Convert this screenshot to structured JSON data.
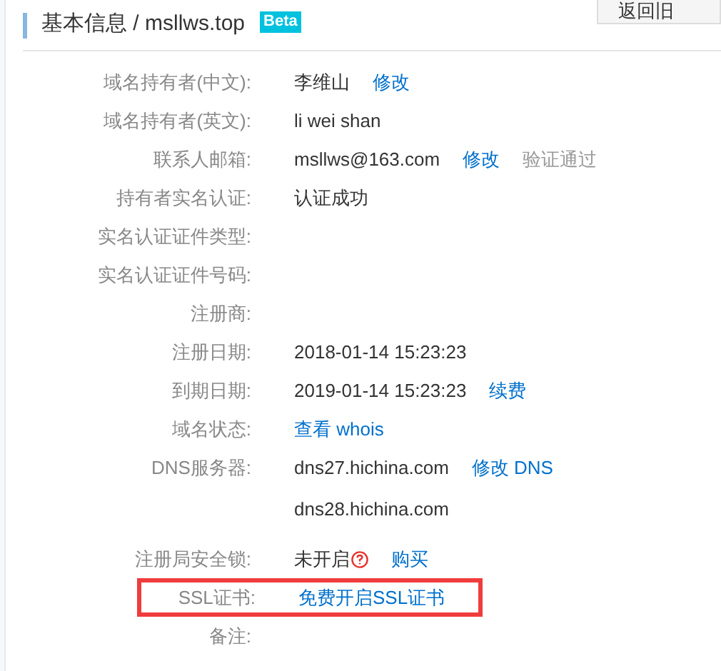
{
  "header": {
    "title": "基本信息 / msllws.top",
    "badge": "Beta",
    "back_button": "返回旧"
  },
  "rows": [
    {
      "label": "域名持有者(中文):",
      "highlighted": false,
      "items": [
        {
          "kind": "text",
          "text": "李维山"
        },
        {
          "kind": "link",
          "text": "修改"
        }
      ]
    },
    {
      "label": "域名持有者(英文):",
      "highlighted": false,
      "items": [
        {
          "kind": "text",
          "text": "li wei shan"
        }
      ]
    },
    {
      "label": "联系人邮箱:",
      "highlighted": false,
      "items": [
        {
          "kind": "text",
          "text": "msllws@163.com"
        },
        {
          "kind": "link",
          "text": "修改"
        },
        {
          "kind": "muted",
          "text": "验证通过"
        }
      ]
    },
    {
      "label": "持有者实名认证:",
      "highlighted": false,
      "items": [
        {
          "kind": "text",
          "text": "认证成功"
        }
      ]
    },
    {
      "label": "实名认证证件类型:",
      "highlighted": false,
      "items": []
    },
    {
      "label": "实名认证证件号码:",
      "highlighted": false,
      "items": []
    },
    {
      "label": "注册商:",
      "highlighted": false,
      "items": []
    },
    {
      "label": "注册日期:",
      "highlighted": false,
      "items": [
        {
          "kind": "text",
          "text": "2018-01-14 15:23:23"
        }
      ]
    },
    {
      "label": "到期日期:",
      "highlighted": false,
      "items": [
        {
          "kind": "text",
          "text": "2019-01-14 15:23:23"
        },
        {
          "kind": "link",
          "text": "续费"
        }
      ]
    },
    {
      "label": "域名状态:",
      "highlighted": false,
      "items": [
        {
          "kind": "link",
          "text": "查看 whois"
        }
      ]
    },
    {
      "label": "DNS服务器:",
      "highlighted": false,
      "items": [
        {
          "kind": "text",
          "text": "dns27.hichina.com"
        },
        {
          "kind": "link",
          "text": "修改 DNS"
        }
      ]
    },
    {
      "label": "",
      "highlighted": false,
      "items": [
        {
          "kind": "text",
          "text": "dns28.hichina.com"
        }
      ]
    },
    {
      "label": "注册局安全锁:",
      "highlighted": false,
      "items": [
        {
          "kind": "help",
          "text": "未开启"
        },
        {
          "kind": "link",
          "text": "购买"
        }
      ]
    },
    {
      "label": "SSL证书:",
      "highlighted": true,
      "items": [
        {
          "kind": "link",
          "text": "免费开启SSL证书"
        }
      ]
    },
    {
      "label": "备注:",
      "highlighted": false,
      "items": []
    }
  ]
}
